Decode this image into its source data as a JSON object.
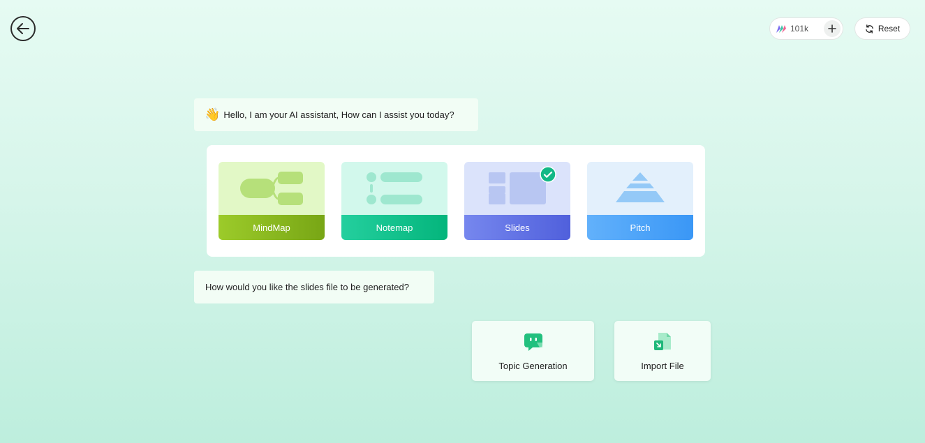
{
  "header": {
    "back_icon": "arrow-left-icon",
    "credits": {
      "logo_icon": "brand-logo-icon",
      "count": "101k",
      "plus_icon": "plus-icon"
    },
    "reset": {
      "icon": "refresh-icon",
      "label": "Reset"
    }
  },
  "chat": {
    "greeting": {
      "emoji": "👋",
      "text": "Hello, I am your AI assistant, How can I assist you today?"
    },
    "question": "How would you like the slides file to be generated?"
  },
  "types": [
    {
      "id": "mindmap",
      "label": "MindMap",
      "icon": "mindmap-icon",
      "selected": false,
      "color": "#8bb820"
    },
    {
      "id": "notemap",
      "label": "Notemap",
      "icon": "notemap-icon",
      "selected": false,
      "color": "#12c28c"
    },
    {
      "id": "slides",
      "label": "Slides",
      "icon": "slides-icon",
      "selected": true,
      "color": "#6372e4"
    },
    {
      "id": "pitch",
      "label": "Pitch",
      "icon": "pitch-icon",
      "selected": false,
      "color": "#4aa3f8"
    }
  ],
  "selected_check_icon": "check-circle-icon",
  "actions": [
    {
      "label": "Topic Generation",
      "icon": "chat-bot-icon"
    },
    {
      "label": "Import File",
      "icon": "import-file-icon"
    }
  ],
  "colors": {
    "accent_green": "#12b886",
    "bg_top": "#e6fbf3",
    "bg_bottom": "#bdeedd"
  }
}
